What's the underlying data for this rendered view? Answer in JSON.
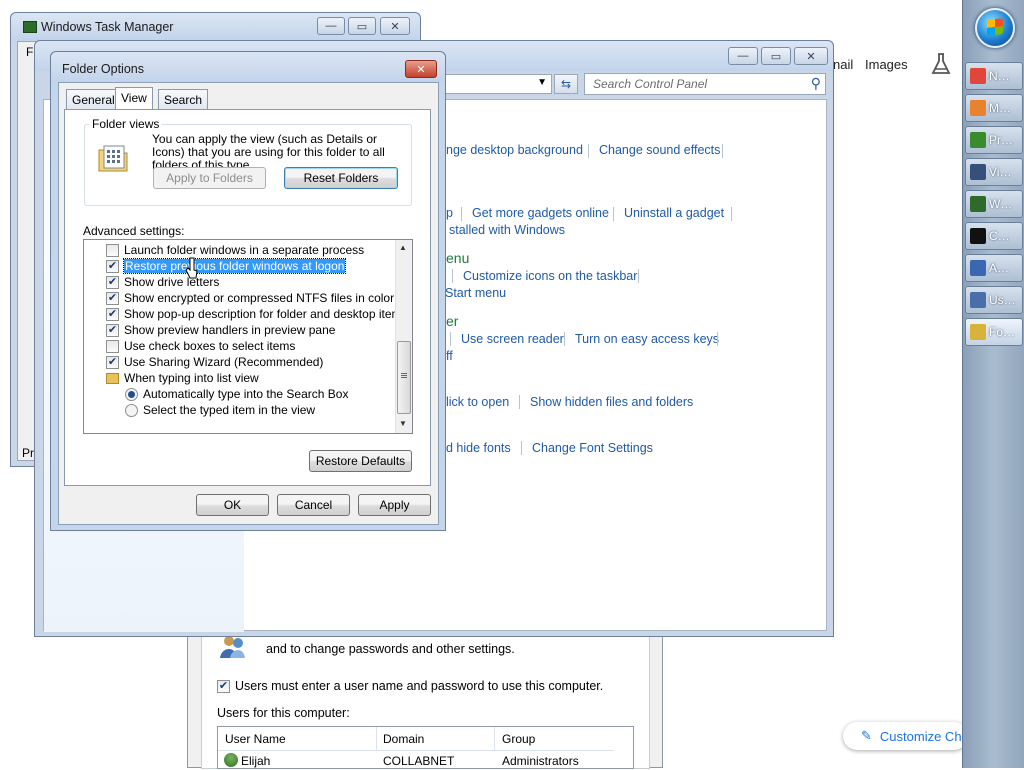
{
  "taskbar": {
    "items": [
      {
        "label": "N…",
        "icon": "chrome-icon",
        "color": "#e0463a"
      },
      {
        "label": "M…",
        "icon": "firefox-icon",
        "color": "#e8822c"
      },
      {
        "label": "Pr…",
        "icon": "project-icon",
        "color": "#3a8a2e"
      },
      {
        "label": "Vi…",
        "icon": "video-icon",
        "color": "#35507a"
      },
      {
        "label": "W…",
        "icon": "task-manager-icon",
        "color": "#2f6a2a"
      },
      {
        "label": "C…",
        "icon": "command-prompt-icon",
        "color": "#111111"
      },
      {
        "label": "A…",
        "icon": "admin-icon",
        "color": "#3b66b2"
      },
      {
        "label": "Us…",
        "icon": "users-icon",
        "color": "#4a6fa8"
      },
      {
        "label": "Fo…",
        "icon": "folder-options-icon",
        "color": "#d9b23a"
      }
    ]
  },
  "task_manager": {
    "title": "Windows Task Manager",
    "menu_partial": "Fi",
    "status_partial": "Pro"
  },
  "browser_bg": {
    "nav_partial": "nail",
    "images": "Images"
  },
  "control_panel": {
    "search_placeholder": "Search Control Panel",
    "links": {
      "desktop_bg": "nge desktop background",
      "sound_effects": "Change sound effects",
      "gadgets_partial": "p",
      "more_gadgets": "Get more gadgets online",
      "uninstall_gadget": "Uninstall a gadget",
      "installed_windows": "stalled with Windows",
      "menu_head": "enu",
      "customize_icons": "Customize icons on the taskbar",
      "start_menu": "Start menu",
      "ease_head": "er",
      "screen_reader": "Use screen reader",
      "easy_keys": "Turn on easy access keys",
      "off_partial": "ff",
      "click_open": "lick to open",
      "hidden_files": "Show hidden files and folders",
      "hide_fonts": "d hide fonts",
      "font_settings": "Change Font Settings"
    }
  },
  "users_dialog": {
    "desc_line": "and to change passwords and other settings.",
    "must_enter": "Users must enter a user name and password to use this computer.",
    "users_label": "Users for this computer:",
    "columns": [
      "User Name",
      "Domain",
      "Group"
    ],
    "rows": [
      {
        "user": "Elijah",
        "domain": "COLLABNET",
        "group": "Administrators"
      }
    ],
    "customize": "Customize Ch"
  },
  "folder_options": {
    "title": "Folder Options",
    "tabs": [
      "General",
      "View",
      "Search"
    ],
    "folder_views_label": "Folder views",
    "folder_views_desc": "You can apply the view (such as Details or Icons) that you are using for this folder to all folders of this type.",
    "apply_to_folders": "Apply to Folders",
    "reset_folders": "Reset Folders",
    "advanced_label": "Advanced settings:",
    "settings": [
      {
        "label": "Launch folder windows in a separate process",
        "kind": "checkbox",
        "checked": false
      },
      {
        "label": "Restore previous folder windows at logon",
        "kind": "checkbox",
        "checked": true,
        "selected": true
      },
      {
        "label": "Show drive letters",
        "kind": "checkbox",
        "checked": true
      },
      {
        "label": "Show encrypted or compressed NTFS files in color",
        "kind": "checkbox",
        "checked": true
      },
      {
        "label": "Show pop-up description for folder and desktop items",
        "kind": "checkbox",
        "checked": true
      },
      {
        "label": "Show preview handlers in preview pane",
        "kind": "checkbox",
        "checked": true
      },
      {
        "label": "Use check boxes to select items",
        "kind": "checkbox",
        "checked": false
      },
      {
        "label": "Use Sharing Wizard (Recommended)",
        "kind": "checkbox",
        "checked": true
      },
      {
        "label": "When typing into list view",
        "kind": "folder"
      },
      {
        "label": "Automatically type into the Search Box",
        "kind": "radio",
        "checked": true
      },
      {
        "label": "Select the typed item in the view",
        "kind": "radio",
        "checked": false
      }
    ],
    "restore_defaults": "Restore Defaults",
    "ok": "OK",
    "cancel": "Cancel",
    "apply": "Apply"
  }
}
